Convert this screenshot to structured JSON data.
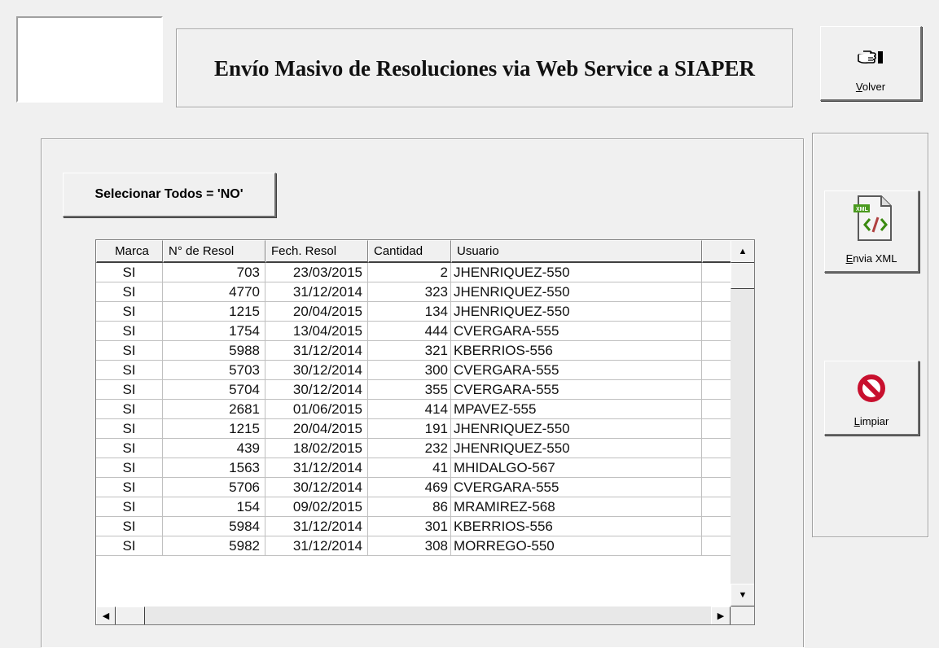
{
  "header": {
    "title": "Envío Masivo de Resoluciones via Web Service a SIAPER"
  },
  "toolbar": {
    "volver_prefix": "",
    "volver_mnemonic": "V",
    "volver_rest": "olver",
    "volver_icon": "pointing-hand-icon",
    "envia_mnemonic": "E",
    "envia_rest": "nvia XML",
    "envia_icon": "xml-file-icon",
    "limpiar_mnemonic": "L",
    "limpiar_rest": "impiar",
    "limpiar_icon": "no-sign-icon"
  },
  "selection": {
    "toggle_label": "Selecionar Todos = 'NO'"
  },
  "grid": {
    "columns": [
      "Marca",
      "N° de Resol",
      "Fech. Resol",
      "Cantidad",
      "Usuario",
      ""
    ],
    "rows": [
      {
        "marca": "SI",
        "resol": "703",
        "fecha": "23/03/2015",
        "cantidad": "2",
        "usuario": "JHENRIQUEZ-550"
      },
      {
        "marca": "SI",
        "resol": "4770",
        "fecha": "31/12/2014",
        "cantidad": "323",
        "usuario": "JHENRIQUEZ-550"
      },
      {
        "marca": "SI",
        "resol": "1215",
        "fecha": "20/04/2015",
        "cantidad": "134",
        "usuario": "JHENRIQUEZ-550"
      },
      {
        "marca": "SI",
        "resol": "1754",
        "fecha": "13/04/2015",
        "cantidad": "444",
        "usuario": "CVERGARA-555"
      },
      {
        "marca": "SI",
        "resol": "5988",
        "fecha": "31/12/2014",
        "cantidad": "321",
        "usuario": "KBERRIOS-556"
      },
      {
        "marca": "SI",
        "resol": "5703",
        "fecha": "30/12/2014",
        "cantidad": "300",
        "usuario": "CVERGARA-555"
      },
      {
        "marca": "SI",
        "resol": "5704",
        "fecha": "30/12/2014",
        "cantidad": "355",
        "usuario": "CVERGARA-555"
      },
      {
        "marca": "SI",
        "resol": "2681",
        "fecha": "01/06/2015",
        "cantidad": "414",
        "usuario": "MPAVEZ-555"
      },
      {
        "marca": "SI",
        "resol": "1215",
        "fecha": "20/04/2015",
        "cantidad": "191",
        "usuario": "JHENRIQUEZ-550"
      },
      {
        "marca": "SI",
        "resol": "439",
        "fecha": "18/02/2015",
        "cantidad": "232",
        "usuario": "JHENRIQUEZ-550"
      },
      {
        "marca": "SI",
        "resol": "1563",
        "fecha": "31/12/2014",
        "cantidad": "41",
        "usuario": "MHIDALGO-567"
      },
      {
        "marca": "SI",
        "resol": "5706",
        "fecha": "30/12/2014",
        "cantidad": "469",
        "usuario": "CVERGARA-555"
      },
      {
        "marca": "SI",
        "resol": "154",
        "fecha": "09/02/2015",
        "cantidad": "86",
        "usuario": "MRAMIREZ-568"
      },
      {
        "marca": "SI",
        "resol": "5984",
        "fecha": "31/12/2014",
        "cantidad": "301",
        "usuario": "KBERRIOS-556"
      },
      {
        "marca": "SI",
        "resol": "5982",
        "fecha": "31/12/2014",
        "cantidad": "308",
        "usuario": "MORREGO-550"
      }
    ]
  }
}
